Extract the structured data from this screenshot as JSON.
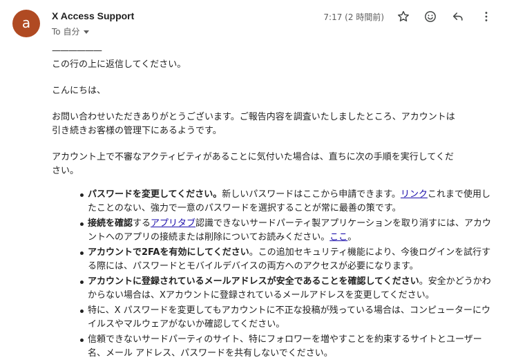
{
  "header": {
    "avatar_letter": "a",
    "sender": "X Access Support",
    "recipient": "To 自分",
    "timestamp": "7:17 (2 時間前)",
    "icons": [
      "star-icon",
      "emoji-icon",
      "reply-icon",
      "more-vert-icon"
    ],
    "avatar_color": "#b04a22"
  },
  "body": {
    "separator": "——————",
    "reply_above": "この行の上に返信してください。",
    "greeting": "こんにちは、",
    "para1_line1": "お問い合わせいただきありがとうございます。ご報告内容を調査いたしましたところ、アカウントは",
    "para1_line2": "引き続きお客様の管理下にあるようです。",
    "para2_line1": "アカウント上で不審なアクティビティがあることに気付いた場合は、直ちに次の手順を実行してくだ",
    "para2_line2": "さい。",
    "steps": [
      {
        "bold": "パスワードを変更してください。",
        "text_before_link": "新しいパスワードはここから申請できます。",
        "link": "リンク",
        "text_after_link": "これまで使用したことのない、強力で一意のパスワードを選択することが常に最善の策です。"
      },
      {
        "bold": "接続を確認",
        "text_before_link": "する",
        "link": "アプリタブ",
        "text_after_link": "認識できないサードパーティ製アプリケーションを取り消すには、アカウントへのアプリの接続または削除についてお読みください。",
        "link2": "ここ",
        "text_end": "。"
      },
      {
        "bold": "アカウントで2FAを有効にしてください",
        "text": "。この追加セキュリティ機能により、今後ログインを試行する際には、パスワードとモバイルデバイスの両方へのアクセスが必要になります。"
      },
      {
        "bold": "アカウントに登録されているメールアドレスが安全であることを確認してください",
        "text": "。安全かどうかわからない場合は、Xアカウントに登録されているメールアドレスを変更してください。"
      },
      {
        "text": "特に、X パスワードを変更してもアカウントに不正な投稿が残っている場合は、コンピューターにウイルスやマルウェアがないか確認してください。"
      },
      {
        "text": "信頼できないサードパーティのサイト、特にフォロワーを増やすことを約束するサイトとユーザー名、メール アドレス、パスワードを共有しないでください。"
      }
    ],
    "link_color": "#1a0dab"
  }
}
